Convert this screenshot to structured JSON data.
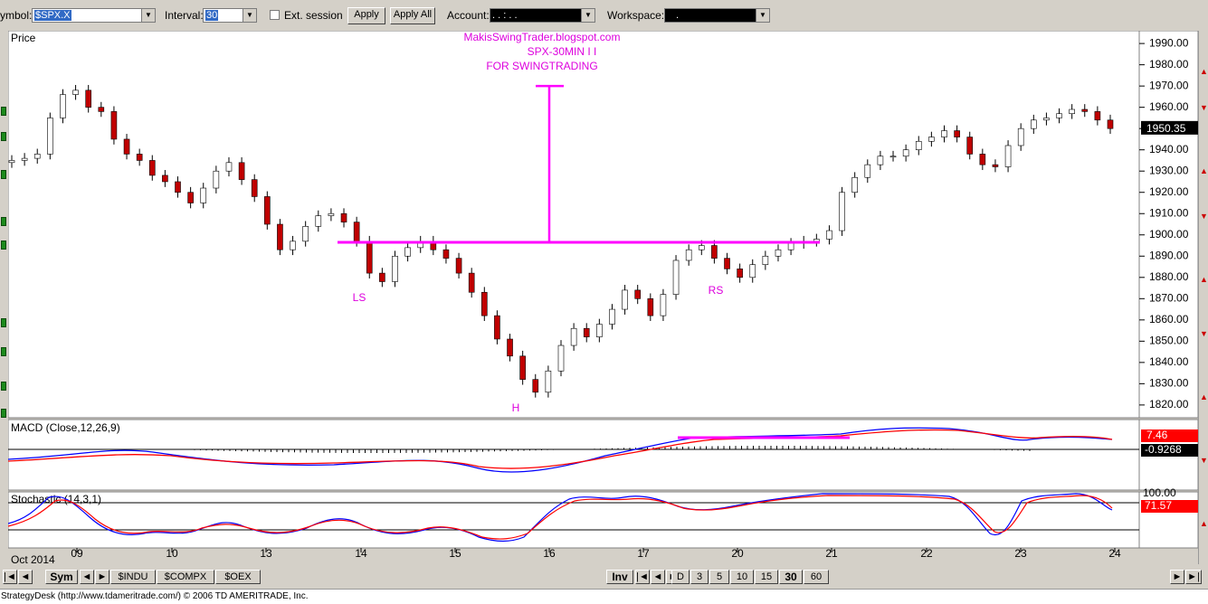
{
  "toolbar": {
    "symbol_label": "ymbol:",
    "symbol_value": "$SPX.X",
    "interval_label": "Interval:",
    "interval_value": "30",
    "ext_session_label": "Ext. session",
    "ext_session_checked": false,
    "apply_label": "Apply",
    "apply_all_label": "Apply All",
    "account_label": "Account:",
    "account_value": ".  .  :  .  .",
    "workspace_label": "Workspace:",
    "workspace_value": "."
  },
  "chart_data": [
    {
      "type": "candlestick",
      "panel_label": "Price",
      "annotation_lines": [
        "MakisSwingTrader.blogspot.com",
        "SPX-30MIN  I I",
        "FOR SWINGTRADING"
      ],
      "pattern_labels": {
        "left_shoulder": "LS",
        "head": "H",
        "right_shoulder": "RS"
      },
      "neckline_level": 1896.5,
      "target_level": 1970,
      "last_price": "1950.35",
      "ylim": [
        1814,
        1996
      ],
      "yticks": [
        "1990.00",
        "1980.00",
        "1970.00",
        "1960.00",
        "1950.00",
        "1940.00",
        "1930.00",
        "1920.00",
        "1910.00",
        "1900.00",
        "1890.00",
        "1880.00",
        "1870.00",
        "1860.00",
        "1850.00",
        "1840.00",
        "1830.00",
        "1820.00"
      ],
      "close_path": [
        1935,
        1936,
        1938,
        1955,
        1966,
        1968,
        1960,
        1958,
        1945,
        1938,
        1935,
        1928,
        1925,
        1920,
        1915,
        1922,
        1930,
        1934,
        1926,
        1918,
        1905,
        1893,
        1897,
        1904,
        1909,
        1910,
        1906,
        1897,
        1882,
        1878,
        1890,
        1894,
        1897,
        1893,
        1889,
        1882,
        1873,
        1862,
        1851,
        1843,
        1832,
        1826,
        1836,
        1848,
        1856,
        1852,
        1858,
        1865,
        1874,
        1870,
        1862,
        1872,
        1888,
        1893,
        1895,
        1889,
        1884,
        1880,
        1886,
        1890,
        1893,
        1896,
        1897,
        1898,
        1902,
        1920,
        1927,
        1933,
        1937,
        1937,
        1940,
        1944,
        1946,
        1949,
        1946,
        1938,
        1933,
        1932,
        1942,
        1950,
        1954,
        1955,
        1957,
        1959,
        1958,
        1954,
        1950
      ]
    },
    {
      "type": "line",
      "panel_label": "MACD (Close,12,26,9)",
      "series": [
        {
          "name": "MACD",
          "color": "#0000ff"
        },
        {
          "name": "Signal",
          "color": "#ff0000"
        }
      ],
      "value_labels": [
        "7.46",
        "-0.9268"
      ]
    },
    {
      "type": "line",
      "panel_label": "Stochastic (14,3,1)",
      "series": [
        {
          "name": "%K",
          "color": "#0000ff"
        },
        {
          "name": "%D",
          "color": "#ff0000"
        }
      ],
      "value_labels": [
        "100.00",
        "71.57"
      ],
      "x_tick_labels": [
        "09",
        "10",
        "13",
        "14",
        "15",
        "16",
        "17",
        "20",
        "21",
        "22",
        "23",
        "24"
      ],
      "month_label": "Oct 2014"
    }
  ],
  "colors": {
    "up_candle": "#ffffff",
    "down_candle": "#c00000",
    "annotation": "#dd00dd",
    "macd_badge": "#ff0000",
    "last_price_badge": "#000000"
  },
  "symbol_tabs": {
    "sym_label": "Sym",
    "items": [
      "$INDU",
      "$COMPX",
      "$OEX"
    ]
  },
  "interval_tabs": {
    "inv_label": "Inv",
    "items": [
      "D",
      "3",
      "5",
      "10",
      "15",
      "30",
      "60"
    ],
    "active": "30"
  },
  "status_text": "StrategyDesk (http://www.tdameritrade.com/) © 2006 TD AMERITRADE, Inc."
}
